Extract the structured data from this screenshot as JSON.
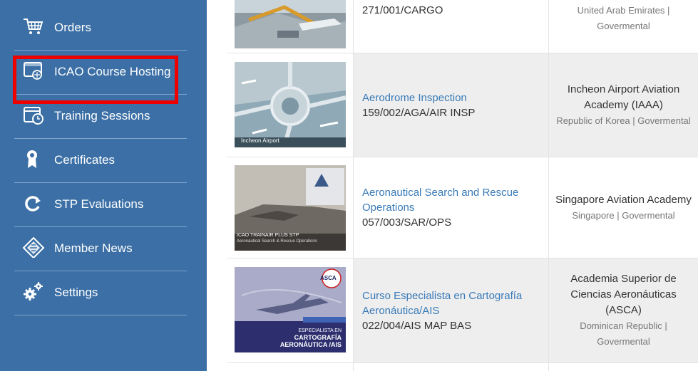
{
  "sidebar": {
    "items": [
      {
        "label": "Orders",
        "icon": "shopping-cart-icon"
      },
      {
        "label": "ICAO Course Hosting",
        "icon": "course-hosting-icon"
      },
      {
        "label": "Training Sessions",
        "icon": "calendar-clock-icon"
      },
      {
        "label": "Certificates",
        "icon": "award-ribbon-icon"
      },
      {
        "label": "STP Evaluations",
        "icon": "refresh-arrow-icon"
      },
      {
        "label": "Member News",
        "icon": "newspaper-icon"
      },
      {
        "label": "Settings",
        "icon": "gears-icon"
      }
    ],
    "highlighted_item": "ICAO Course Hosting"
  },
  "courses": [
    {
      "title": "",
      "code": "271/001/CARGO",
      "provider": "",
      "provider_meta": "United Arab Emirates | Govermental",
      "thumbnail_caption": ""
    },
    {
      "title": "Aerodrome Inspection",
      "code": "159/002/AGA/AIR INSP",
      "provider": "Incheon Airport Aviation Academy (IAAA)",
      "provider_meta": "Republic of Korea | Govermental",
      "thumbnail_caption": "Incheon Airport"
    },
    {
      "title": "Aeronautical Search and Rescue Operations",
      "code": "057/003/SAR/OPS",
      "provider": "Singapore Aviation Academy",
      "provider_meta": "Singapore | Govermental",
      "thumbnail_caption": "ICAO TRAINAIR PLUS STP",
      "thumbnail_subcaption": "Aeronautical Search & Rescue Operations"
    },
    {
      "title": "Curso Especialista en Cartografía Aeronáutica/AIS",
      "code": "022/004/AIS MAP BAS",
      "provider": "Academia Superior de Ciencias Aeronáuticas (ASCA)",
      "provider_meta": "Dominican Republic | Govermental",
      "thumbnail_caption": "ESPECIALISTA EN",
      "thumbnail_subcaption": "CARTOGRAFÍA AERONÁUTICA /AIS",
      "thumbnail_badge": "ASCA"
    }
  ],
  "colors": {
    "sidebar_bg": "#3b6fa5",
    "link": "#3a7bb8",
    "highlight": "#ee0000",
    "row_alt": "#eeeeee"
  }
}
